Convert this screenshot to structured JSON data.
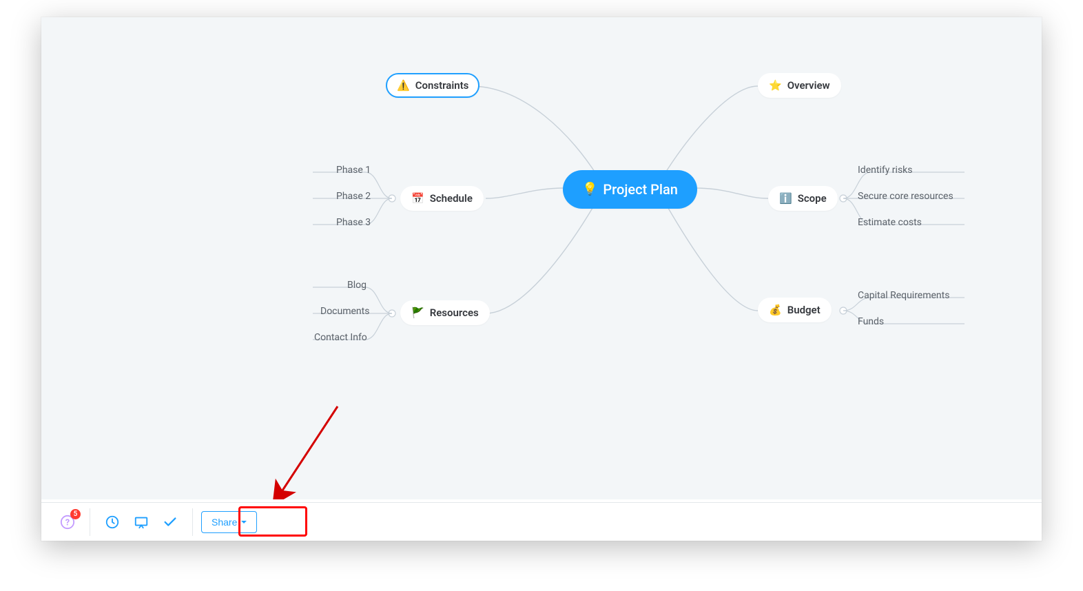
{
  "mindmap": {
    "center": {
      "label": "Project Plan",
      "icon": "💡"
    },
    "constraints": {
      "label": "Constraints",
      "icon": "⚠️"
    },
    "overview": {
      "label": "Overview",
      "icon": "⭐"
    },
    "schedule": {
      "label": "Schedule",
      "icon": "📅",
      "children": {
        "0": "Phase 1",
        "1": "Phase 2",
        "2": "Phase 3"
      }
    },
    "scope": {
      "label": "Scope",
      "icon": "ℹ️",
      "children": {
        "0": "Identify risks",
        "1": "Secure core resources",
        "2": "Estimate costs"
      }
    },
    "resources": {
      "label": "Resources",
      "icon": "🚩",
      "children": {
        "0": "Blog",
        "1": "Documents",
        "2": "Contact Info"
      }
    },
    "budget": {
      "label": "Budget",
      "icon": "💰",
      "children": {
        "0": "Capital Requirements",
        "1": "Funds"
      }
    }
  },
  "toolbar": {
    "notifications_badge": "5",
    "share_label": "Share"
  }
}
